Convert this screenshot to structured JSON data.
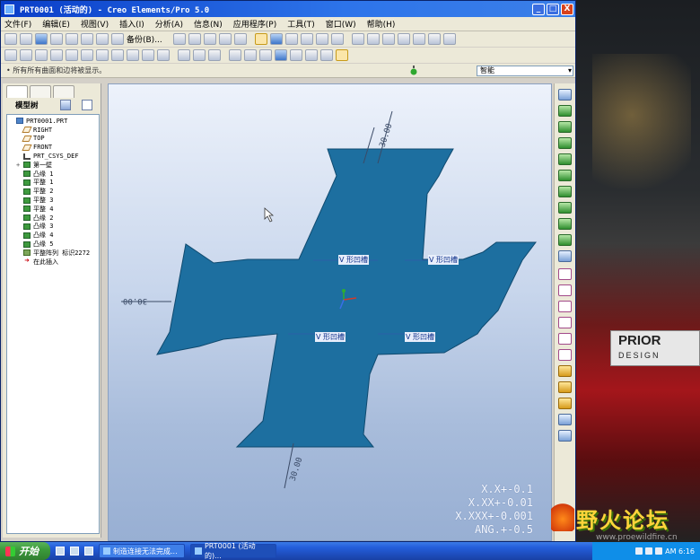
{
  "window": {
    "title": "PRT0001 (活动的) - Creo Elements/Pro 5.0",
    "controls": [
      "_",
      "□",
      "X"
    ]
  },
  "menubar": [
    "文件(F)",
    "编辑(E)",
    "视图(V)",
    "插入(I)",
    "分析(A)",
    "信息(N)",
    "应用程序(P)",
    "工具(T)",
    "窗口(W)",
    "帮助(H)"
  ],
  "toolbar": {
    "backup_label": "备份(B)..."
  },
  "message": "• 所有所有曲面和边将被显示。",
  "filter": {
    "value": "智能"
  },
  "model_tree": {
    "title": "模型树",
    "items": [
      {
        "label": "PRT0001.PRT",
        "icon": "part-icon",
        "indent": 0,
        "expand": ""
      },
      {
        "label": "RIGHT",
        "icon": "datum-plane-icon",
        "indent": 1,
        "expand": ""
      },
      {
        "label": "TOP",
        "icon": "datum-plane-icon",
        "indent": 1,
        "expand": ""
      },
      {
        "label": "FRONT",
        "icon": "datum-plane-icon",
        "indent": 1,
        "expand": ""
      },
      {
        "label": "PRT_CSYS_DEF",
        "icon": "csys-icon",
        "indent": 1,
        "expand": ""
      },
      {
        "label": "第一壁",
        "icon": "feature-icon",
        "indent": 1,
        "expand": "+"
      },
      {
        "label": "凸缘 1",
        "icon": "feature-icon",
        "indent": 1,
        "expand": ""
      },
      {
        "label": "平整 1",
        "icon": "feature-icon",
        "indent": 1,
        "expand": ""
      },
      {
        "label": "平整 2",
        "icon": "feature-icon",
        "indent": 1,
        "expand": ""
      },
      {
        "label": "平整 3",
        "icon": "feature-icon",
        "indent": 1,
        "expand": ""
      },
      {
        "label": "平整 4",
        "icon": "feature-icon",
        "indent": 1,
        "expand": ""
      },
      {
        "label": "凸缘 2",
        "icon": "feature-icon",
        "indent": 1,
        "expand": ""
      },
      {
        "label": "凸缘 3",
        "icon": "feature-icon",
        "indent": 1,
        "expand": ""
      },
      {
        "label": "凸缘 4",
        "icon": "feature-icon",
        "indent": 1,
        "expand": ""
      },
      {
        "label": "凸缘 5",
        "icon": "feature-icon",
        "indent": 1,
        "expand": ""
      },
      {
        "label": "平整阵列 标识2272",
        "icon": "pattern-icon",
        "indent": 1,
        "expand": ""
      },
      {
        "label": "在此插入",
        "icon": "insert-here-icon",
        "indent": 1,
        "expand": ""
      }
    ]
  },
  "graphics": {
    "notch_labels": [
      "V 形凹槽",
      "V 形凹槽",
      "V 形凹槽",
      "V 形凹槽"
    ],
    "dimension_labels": [
      "30.00",
      "30.00",
      "30.00"
    ],
    "tolerances": [
      "X.X+-0.1",
      "X.XX+-0.01",
      "X.XXX+-0.001",
      "ANG.+-0.5"
    ],
    "part_color": "#1d6fa0",
    "background_top": "#edf2fb",
    "background_bottom": "#98afd3"
  },
  "taskbar": {
    "start_label": "开始",
    "tasks": [
      "制造连接无法完成...",
      "PRT0001 (活动的)..."
    ],
    "clock": "AM 6:16"
  },
  "wallpaper": {
    "plate_line1": "PRIOR",
    "plate_line2": "DESIGN"
  },
  "watermark": {
    "text": "野火论坛",
    "url": "www.proewildfire.cn"
  }
}
